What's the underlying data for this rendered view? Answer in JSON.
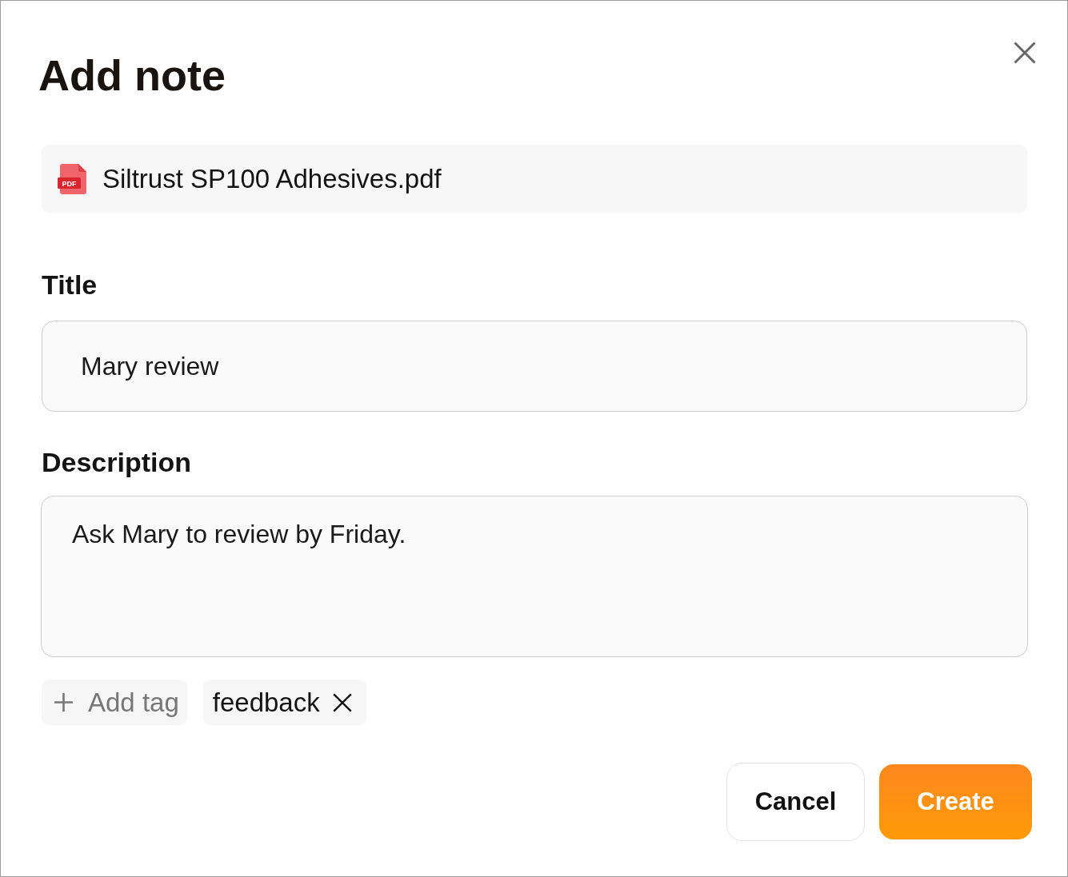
{
  "dialog": {
    "title": "Add note"
  },
  "attachment": {
    "icon_text": "PDF",
    "file_name": "Siltrust SP100 Adhesives.pdf"
  },
  "fields": [
    {
      "kind": "input",
      "label": "Title",
      "value": "Mary review"
    },
    {
      "kind": "textarea",
      "label": "Description",
      "value": "Ask Mary to review by Friday."
    }
  ],
  "tags": {
    "add_label": "Add tag",
    "items": [
      {
        "label": "feedback"
      }
    ]
  },
  "buttons": [
    {
      "kind": "secondary",
      "label": "Cancel"
    },
    {
      "kind": "primary",
      "label": "Create"
    }
  ]
}
